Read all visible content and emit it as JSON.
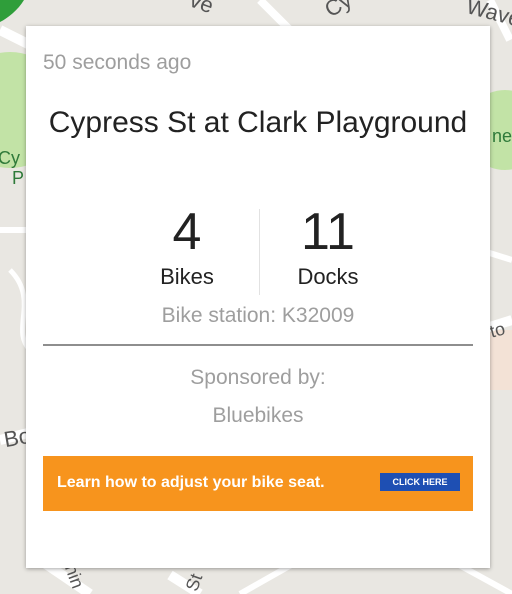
{
  "map": {
    "labels": {
      "top_a": "ve",
      "top_b": "Cy",
      "top_right": "Wave",
      "left_park": "Cy",
      "left_park2": "P",
      "right_park": "ne",
      "right_mid": "to",
      "left_mid": "Bo",
      "bottom_a": "nin",
      "bottom_b": "St"
    }
  },
  "card": {
    "updated": "50 seconds ago",
    "station_name": "Cypress St at Clark Playground",
    "bikes": {
      "count": "4",
      "label": "Bikes"
    },
    "docks": {
      "count": "11",
      "label": "Docks"
    },
    "station_id": "Bike station: K32009",
    "sponsored_label": "Sponsored by:",
    "sponsor": "Bluebikes",
    "ad": {
      "text": "Learn how to adjust your bike seat.",
      "button": "CLICK HERE"
    }
  }
}
